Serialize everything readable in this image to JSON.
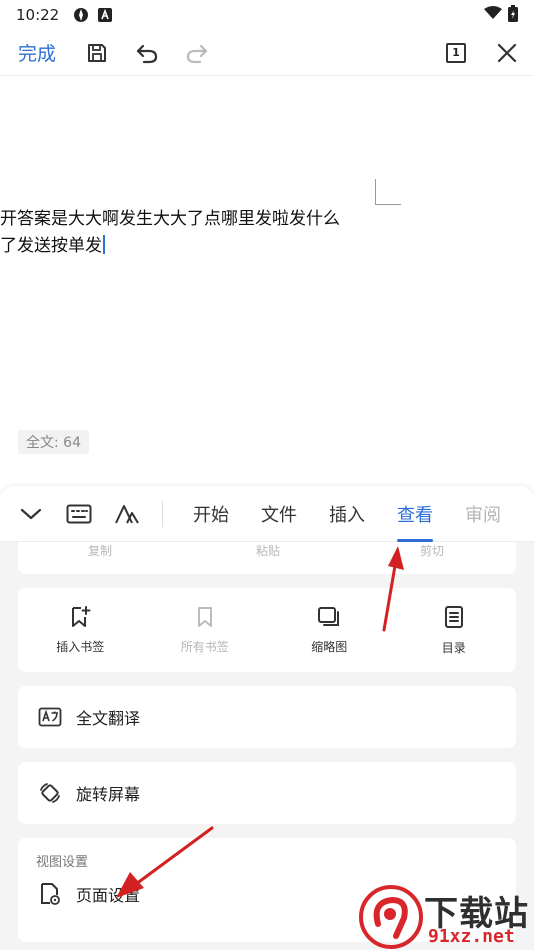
{
  "status_bar": {
    "time": "10:22"
  },
  "toolbar": {
    "done_label": "完成",
    "page_number": "1"
  },
  "document": {
    "lines": [
      "开答案是大大啊发生大大了点哪里发啦发什么",
      "了发送按单发"
    ],
    "word_count": "全文: 64"
  },
  "panel": {
    "tabs": [
      {
        "label": "开始",
        "state": "normal"
      },
      {
        "label": "文件",
        "state": "normal"
      },
      {
        "label": "插入",
        "state": "normal"
      },
      {
        "label": "查看",
        "state": "active"
      },
      {
        "label": "审阅",
        "state": "faded"
      }
    ],
    "clipboard_row": [
      "复制",
      "粘贴",
      "剪切"
    ],
    "grid": [
      {
        "label": "插入书签",
        "icon": "bookmark-add-icon",
        "enabled": true
      },
      {
        "label": "所有书签",
        "icon": "bookmark-icon",
        "enabled": false
      },
      {
        "label": "缩略图",
        "icon": "thumbnail-icon",
        "enabled": true
      },
      {
        "label": "目录",
        "icon": "toc-icon",
        "enabled": true
      }
    ],
    "translate_label": "全文翻译",
    "rotate_label": "旋转屏幕",
    "view_settings": {
      "section_title": "视图设置",
      "page_setup_label": "页面设置"
    }
  },
  "watermark": {
    "title": "下载站",
    "site": "91xz.net"
  },
  "colors": {
    "accent": "#2c6fd6",
    "annotation_arrow": "#d32020"
  }
}
